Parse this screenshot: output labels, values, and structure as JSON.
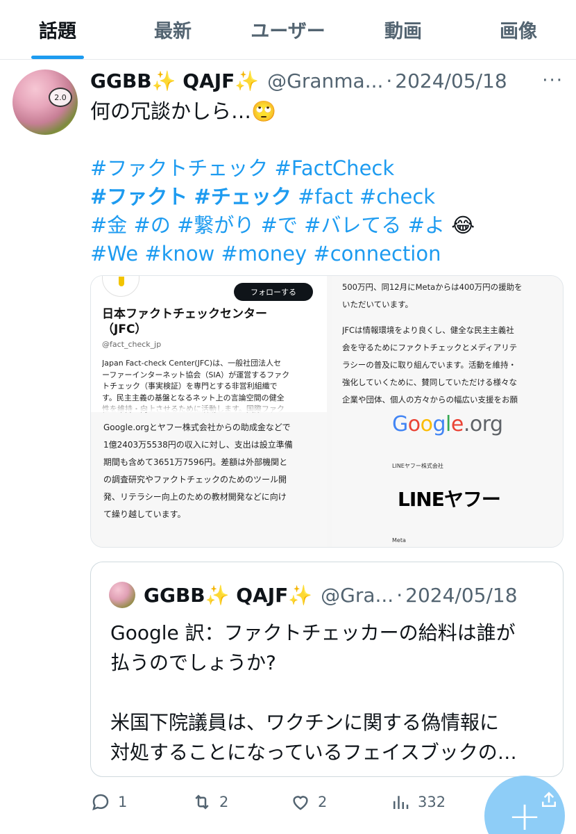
{
  "tabs": [
    {
      "label": "話題",
      "active": true
    },
    {
      "label": "最新",
      "active": false
    },
    {
      "label": "ユーザー",
      "active": false
    },
    {
      "label": "動画",
      "active": false
    },
    {
      "label": "画像",
      "active": false
    }
  ],
  "tweet": {
    "avatar_badge": "2.0",
    "display_name": "GGBB✨ QAJF✨",
    "handle": "@Granma...",
    "dot": "·",
    "date": "2024/05/18",
    "more_label": "···",
    "text_line1": "何の冗談かしら…🙄",
    "hashtag_lines": {
      "l1": [
        "#ファクトチェック",
        "#FactCheck"
      ],
      "l2": [
        "#ファクト",
        "#チェック",
        "#fact",
        "#check"
      ],
      "l3": [
        "#金",
        "#の",
        "#繋がり",
        "#で",
        "#バレてる",
        "#よ"
      ],
      "l3_emoji": "😂",
      "l4": [
        "#We",
        "#know",
        "#money",
        "#connection"
      ]
    }
  },
  "media": {
    "follow_button": "フォローする",
    "jfc_name_line1": "日本ファクトチェックセンター",
    "jfc_name_line2": "（JFC）",
    "jfc_handle": "@fact_check_jp",
    "jfc_desc": [
      "Japan Fact-check Center(JFC)は、一般社団法人セ",
      "ーファーインターネット協会（SIA）が運営するファク",
      "トチェック（事実検証）を専門とする非営利組織で",
      "す。民主主義の基盤となるネット上の言論空間の健全",
      "性を維持・向上させるために活動します。国際ファク"
    ],
    "report_lines": [
      "Google.orgとヤフー株式会社からの助成金などで",
      "1億2403万5538円の収入に対し、支出は設立準備",
      "期間も含めて3651万7596円。差額は外部機関と",
      "の調査研究やファクトチェックのためのツール開",
      "発、リテラシー向上のための教材開発などに向け",
      "て繰り越しています。"
    ],
    "right_lines_p1": [
      "500万円、同12月にMetaからは400万円の援助を",
      "いただいています。"
    ],
    "right_lines_p2": [
      "JFCは情報環境をより良くし、健全な民主主義社",
      "会を守るためにファクトチェックとメディアリテ",
      "ラシーの普及に取り組んでいます。活動を維持・",
      "強化していくために、賛同していただける様々な",
      "企業や団体、個人の方々からの幅広い支援をお願"
    ],
    "google_logo": {
      "G": "G",
      "o1": "o",
      "o2": "o",
      "g": "g",
      "l": "l",
      "e": "e",
      "org": ".org"
    },
    "line_small": "LINEヤフー株式会社",
    "line_logo": "LINEヤフー",
    "meta_small": "Meta"
  },
  "quote": {
    "display_name": "GGBB✨ QAJF✨",
    "handle": "@Gra...",
    "dot": "·",
    "date": "2024/05/18",
    "lines": [
      "Google 訳：ファクトチェッカーの給料は誰が",
      "払うのでしょうか?",
      "",
      "米国下院議員は、ワクチンに関する偽情報に",
      "対処することになっているフェイスブックの…"
    ]
  },
  "actions": {
    "replies": "1",
    "retweets": "2",
    "likes": "2",
    "views": "332"
  },
  "fab_label": "+",
  "colors": {
    "accent": "#1d9bf0",
    "muted": "#536471",
    "text": "#0f1419",
    "fab": "#8ecdf7"
  }
}
